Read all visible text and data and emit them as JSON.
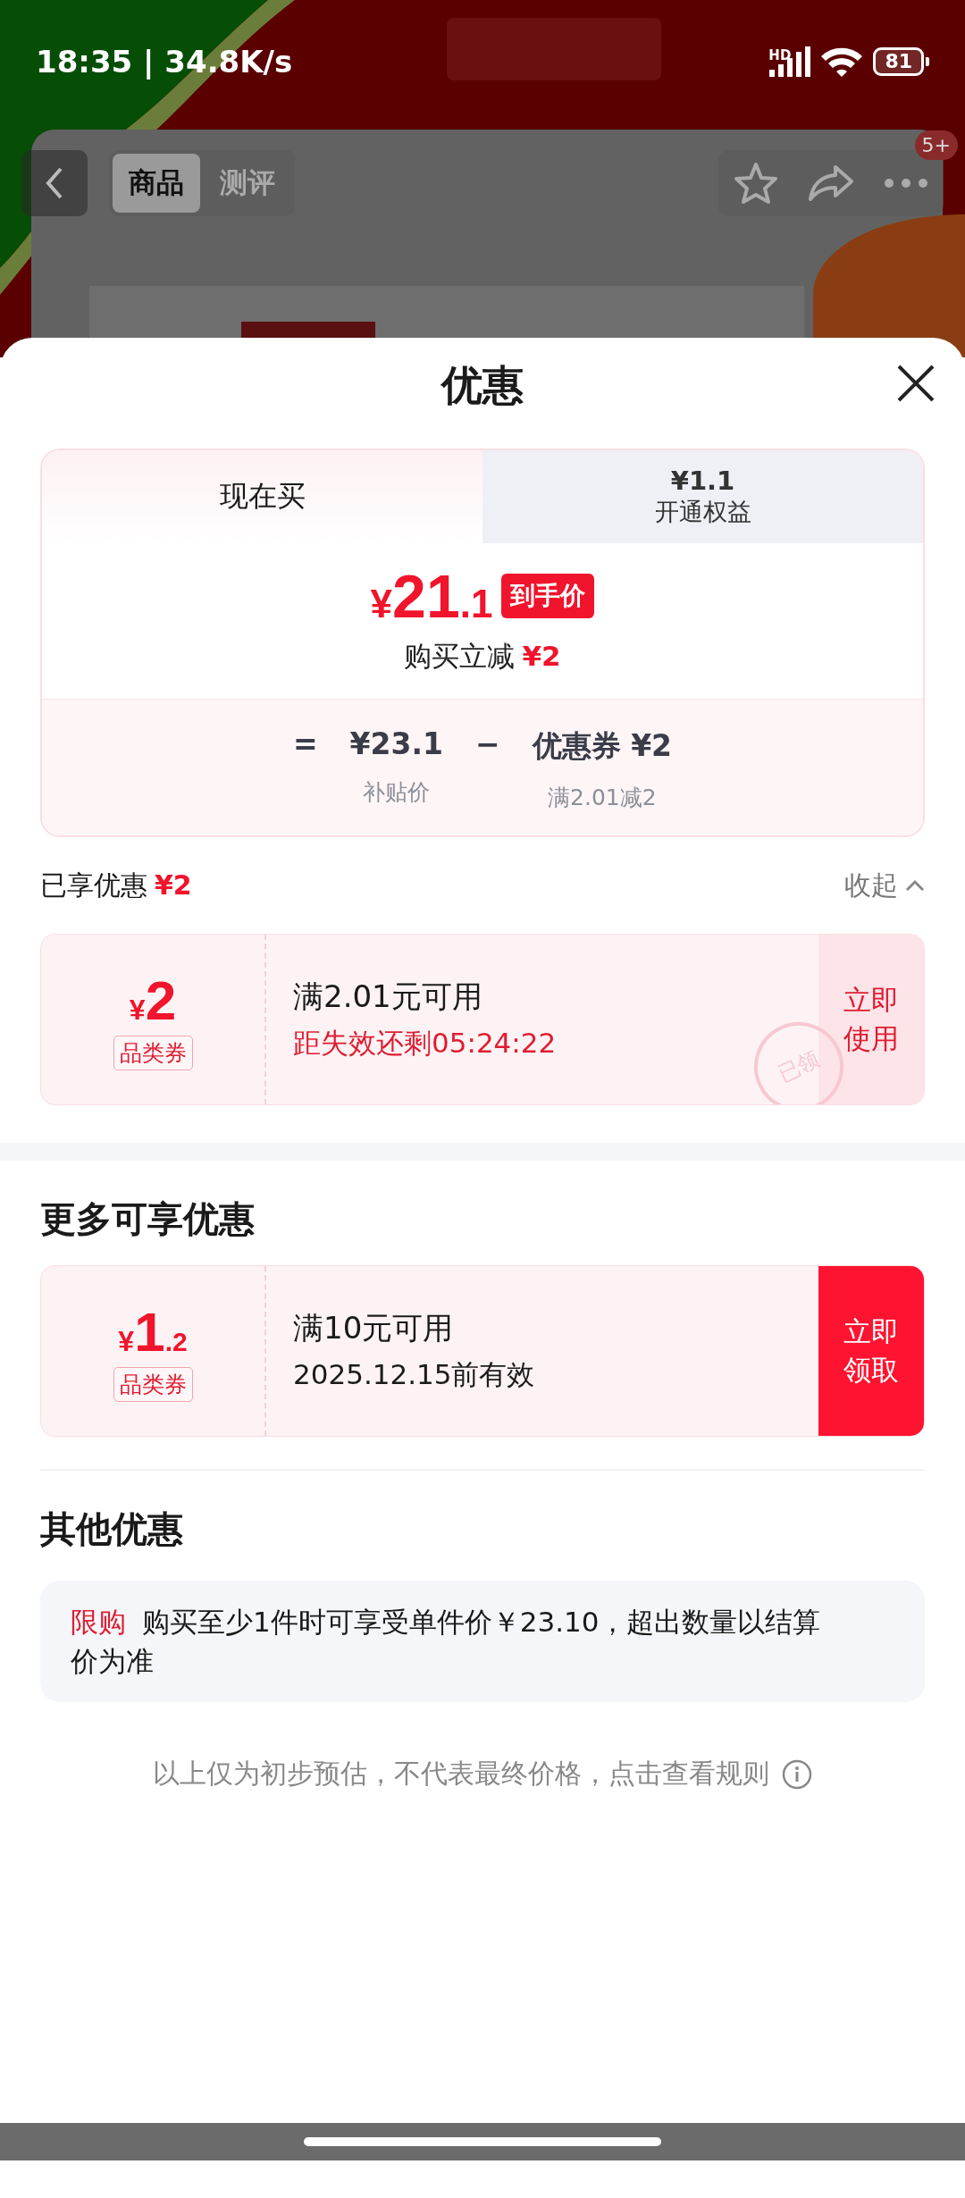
{
  "status_bar": {
    "time": "18:35 | 34.8K/s",
    "network": "HD",
    "battery": "81"
  },
  "nav": {
    "tabs": [
      {
        "label": "商品",
        "selected": true
      },
      {
        "label": "测评",
        "selected": false
      }
    ],
    "badge": "5+"
  },
  "sheet": {
    "title": "优惠",
    "price_card": {
      "tabs": [
        {
          "label": "现在买",
          "selected": true
        },
        {
          "label": "开通权益",
          "price": "¥1.1",
          "selected": false
        }
      ],
      "price": {
        "currency": "¥",
        "integer": "21",
        "decimal": ".1",
        "tag": "到手价"
      },
      "saving": {
        "label": "购买立减",
        "amount": "¥2"
      },
      "formula": [
        {
          "kind": "op",
          "text": "="
        },
        {
          "kind": "term",
          "text": "¥23.1",
          "caption": "补贴价"
        },
        {
          "kind": "op",
          "text": "−"
        },
        {
          "kind": "term",
          "text": "优惠券 ¥2",
          "caption": "满2.01减2"
        }
      ]
    },
    "enjoyed": {
      "label": "已享优惠",
      "amount": "¥2",
      "toggle": "收起",
      "expanded": true
    },
    "coupons": [
      {
        "currency": "¥",
        "integer": "2",
        "tag": "品类券",
        "title": "满2.01元可用",
        "subtitle": "距失效还剩05:24:22",
        "button_lines": [
          "立即",
          "使用"
        ],
        "claimed": true,
        "stamp": "已领"
      }
    ],
    "more_title": "更多可享优惠",
    "more_coupons": [
      {
        "currency": "¥",
        "integer": "1",
        "decimal": ".2",
        "tag": "品类券",
        "title": "满10元可用",
        "subtitle": "2025.12.15前有效",
        "button_lines": [
          "立即",
          "领取"
        ],
        "claimed": false
      }
    ],
    "other_title": "其他优惠",
    "other": [
      {
        "tag": "限购",
        "text": "购买至少1件时可享受单件价￥23.10，超出数量以结算价为准"
      }
    ],
    "footer": "以上仅为初步预估，不代表最终价格，点击查看规则"
  }
}
